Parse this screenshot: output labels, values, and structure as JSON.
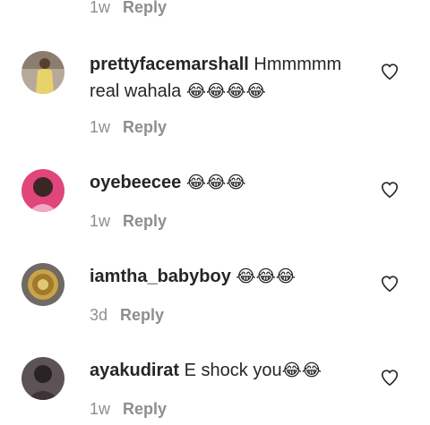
{
  "top_meta": {
    "time": "1w",
    "reply": "Reply"
  },
  "comments": [
    {
      "username": "prettyfacemarshall",
      "text": " Hmmmmm real wahala ",
      "emojis": "😂😂😂😂",
      "time": "1w",
      "reply": "Reply",
      "avatar_icon": "avatar-yellow-dress",
      "like_icon": "heart-outline-icon"
    },
    {
      "username": "oyebeecee",
      "text": " ",
      "emojis": "😂😂😂",
      "time": "1w",
      "reply": "Reply",
      "avatar_icon": "avatar-pink-portrait",
      "like_icon": "heart-outline-icon"
    },
    {
      "username": "iamtha_babyboy",
      "text": " ",
      "emojis": "😂😂😂",
      "time": "3d",
      "reply": "Reply",
      "avatar_icon": "avatar-gold-coin",
      "like_icon": "heart-outline-icon"
    },
    {
      "username": "ayakudirat",
      "text": " E shock you",
      "emojis": "😂😂",
      "time": "1w",
      "reply": "Reply",
      "avatar_icon": "avatar-dark-portrait",
      "like_icon": "heart-outline-icon"
    }
  ],
  "colors": {
    "text": "#262626",
    "secondary": "#8e8e8e",
    "background": "#ffffff"
  }
}
